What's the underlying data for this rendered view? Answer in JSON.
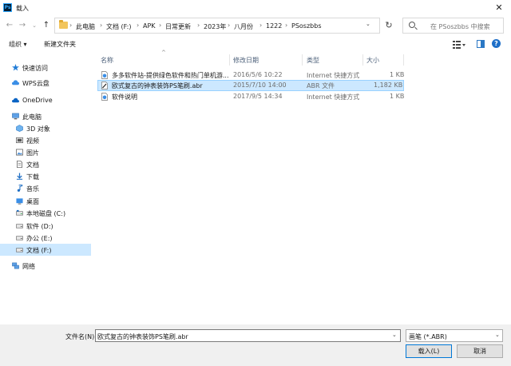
{
  "window": {
    "app_icon_text": "Ps",
    "title": "载入",
    "close_glyph": "✕"
  },
  "nav_buttons": {
    "back": "←",
    "forward": "→",
    "up_menu": "⌄",
    "up": "↑"
  },
  "address": {
    "sep": "›",
    "crumbs": [
      "此电脑",
      "文档 (F:)",
      "APK",
      "日常更新",
      "2023年",
      "八月份",
      "1222",
      "PSoszbbs"
    ],
    "dropdown_glyph": "⌄",
    "refresh_glyph": "↻"
  },
  "search": {
    "placeholder": "在 PSoszbbs 中搜索"
  },
  "toolbar": {
    "organize_label": "组织 ▾",
    "new_folder_label": "新建文件夹",
    "help_glyph": "?"
  },
  "sidebar": {
    "items": [
      {
        "label": "快速访问",
        "icon": "star-icon"
      },
      {
        "label": "WPS云盘",
        "icon": "cloud-icon"
      },
      {
        "label": "OneDrive",
        "icon": "onedrive-icon"
      },
      {
        "label": "此电脑",
        "icon": "computer-icon"
      },
      {
        "label": "3D 对象",
        "icon": "cube-icon"
      },
      {
        "label": "视频",
        "icon": "video-icon"
      },
      {
        "label": "图片",
        "icon": "picture-icon"
      },
      {
        "label": "文档",
        "icon": "document-icon"
      },
      {
        "label": "下载",
        "icon": "download-icon"
      },
      {
        "label": "音乐",
        "icon": "music-icon"
      },
      {
        "label": "桌面",
        "icon": "desktop-icon"
      },
      {
        "label": "本地磁盘 (C:)",
        "icon": "drive-icon"
      },
      {
        "label": "软件 (D:)",
        "icon": "drive-icon"
      },
      {
        "label": "办公 (E:)",
        "icon": "drive-icon"
      },
      {
        "label": "文档 (F:)",
        "icon": "drive-icon"
      },
      {
        "label": "网络",
        "icon": "network-icon"
      }
    ]
  },
  "file_list": {
    "sort_caret": "^",
    "columns": [
      "名称",
      "修改日期",
      "类型",
      "大小"
    ],
    "rows": [
      {
        "name": "多多软件站-提供绿色软件和热门单机游...",
        "date": "2016/5/6 10:22",
        "type": "Internet 快捷方式",
        "size": "1 KB",
        "icon": "internet-shortcut-icon"
      },
      {
        "name": "欧式复古的钟表装饰PS笔刷.abr",
        "date": "2015/7/10 14:00",
        "type": "ABR 文件",
        "size": "1,182 KB",
        "icon": "abr-file-icon"
      },
      {
        "name": "软件说明",
        "date": "2017/9/5 14:34",
        "type": "Internet 快捷方式",
        "size": "1 KB",
        "icon": "internet-shortcut-icon"
      }
    ]
  },
  "bottom": {
    "filename_label": "文件名(N):",
    "filename_value": "欧式复古的钟表装饰PS笔刷.abr",
    "filetype_value": "画笔 (*.ABR)",
    "dropdown_glyph": "⌄",
    "load_label": "载入(L)",
    "cancel_label": "取消"
  },
  "colors": {
    "selection": "#cce8ff",
    "accent": "#0078d7"
  }
}
